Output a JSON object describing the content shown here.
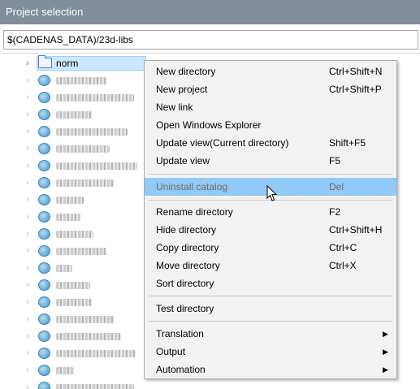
{
  "window": {
    "title": "Project selection"
  },
  "path": {
    "value": "$(CADENAS_DATA)/23d-libs"
  },
  "tree": {
    "first_item": {
      "label": "norm",
      "expander": "›"
    },
    "blurred_count": 19
  },
  "context_menu": {
    "group1": [
      {
        "label": "New directory",
        "shortcut": "Ctrl+Shift+N"
      },
      {
        "label": "New project",
        "shortcut": "Ctrl+Shift+P"
      },
      {
        "label": "New link",
        "shortcut": ""
      },
      {
        "label": "Open Windows Explorer",
        "shortcut": ""
      },
      {
        "label": "Update view(Current directory)",
        "shortcut": "Shift+F5"
      },
      {
        "label": "Update view",
        "shortcut": "F5"
      }
    ],
    "group2": [
      {
        "label": "Uninstall catalog",
        "shortcut": "Del"
      }
    ],
    "group3": [
      {
        "label": "Rename directory",
        "shortcut": "F2"
      },
      {
        "label": "Hide directory",
        "shortcut": "Ctrl+Shift+H"
      },
      {
        "label": "Copy directory",
        "shortcut": "Ctrl+C"
      },
      {
        "label": "Move directory",
        "shortcut": "Ctrl+X"
      },
      {
        "label": "Sort directory",
        "shortcut": ""
      }
    ],
    "group4": [
      {
        "label": "Test directory",
        "shortcut": ""
      }
    ],
    "group5": [
      {
        "label": "Translation",
        "arrow": "▶"
      },
      {
        "label": "Output",
        "arrow": "▶"
      },
      {
        "label": "Automation",
        "arrow": "▶"
      }
    ]
  },
  "colors": {
    "titlebar": "#808d9a",
    "menu_highlight": "#91c9f7",
    "selection": "#cce8ff"
  }
}
